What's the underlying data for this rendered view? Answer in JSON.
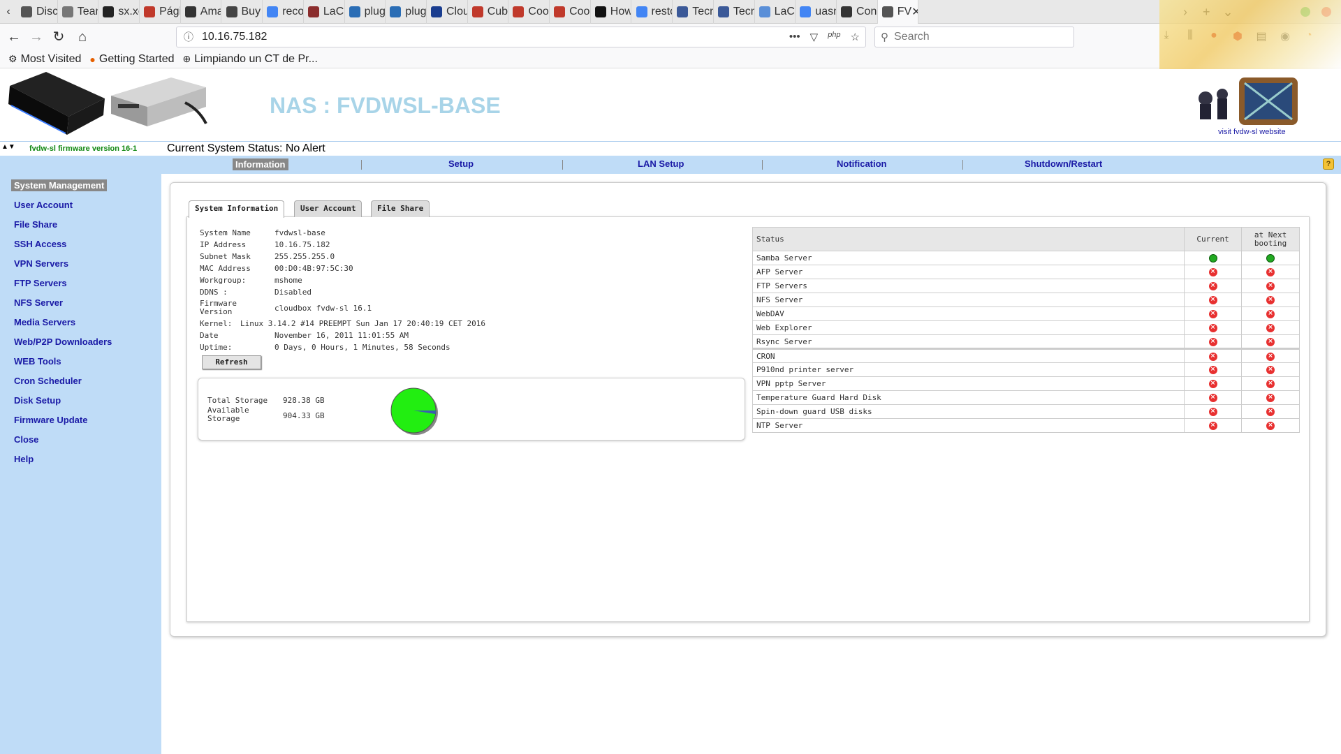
{
  "browser": {
    "tabs": [
      {
        "label": "Disc",
        "color": "#555"
      },
      {
        "label": "Team",
        "color": "#777"
      },
      {
        "label": "sx.xe",
        "color": "#222"
      },
      {
        "label": "Págir",
        "color": "#c0392b"
      },
      {
        "label": "Ama",
        "color": "#333"
      },
      {
        "label": "Buy",
        "color": "#444"
      },
      {
        "label": "recov",
        "color": "#4285f4"
      },
      {
        "label": "LaCi",
        "color": "#8b2d2d"
      },
      {
        "label": "plugc",
        "color": "#2a6db5"
      },
      {
        "label": "pluge",
        "color": "#2a6db5"
      },
      {
        "label": "Clou",
        "color": "#1a3d8f"
      },
      {
        "label": "Cuba",
        "color": "#c0392b"
      },
      {
        "label": "Coop",
        "color": "#c0392b"
      },
      {
        "label": "Coop",
        "color": "#c0392b"
      },
      {
        "label": "How",
        "color": "#111"
      },
      {
        "label": "resto",
        "color": "#4285f4"
      },
      {
        "label": "Tecn",
        "color": "#3b5998"
      },
      {
        "label": "Tecn",
        "color": "#3b5998"
      },
      {
        "label": "LaCi",
        "color": "#5a8fd8"
      },
      {
        "label": "uasn",
        "color": "#4285f4"
      },
      {
        "label": "Con",
        "color": "#333"
      },
      {
        "label": "FV",
        "color": "#555"
      }
    ],
    "url": "10.16.75.182",
    "url_badge": "php",
    "search_placeholder": "Search",
    "bookmarks": [
      {
        "label": "Most Visited",
        "icon": "gear-icon"
      },
      {
        "label": "Getting Started",
        "icon": "firefox-icon"
      },
      {
        "label": "Limpiando un CT de Pr...",
        "icon": "globe-icon"
      }
    ]
  },
  "header": {
    "title": "NAS : FVDWSL-BASE",
    "visit_link": "visit fvdw-sl website",
    "firmware_version": "fvdw-sl firmware version 16-1",
    "current_status": "Current System Status:  No Alert"
  },
  "menu": [
    {
      "label": "Information",
      "active": true
    },
    {
      "label": "Setup",
      "active": false
    },
    {
      "label": "LAN Setup",
      "active": false
    },
    {
      "label": "Notification",
      "active": false
    },
    {
      "label": "Shutdown/Restart",
      "active": false
    }
  ],
  "sidebar": [
    "System Management",
    "User Account",
    "File Share",
    "SSH Access",
    "VPN Servers",
    "FTP Servers",
    "NFS Server",
    "Media Servers",
    "Web/P2P Downloaders",
    "WEB Tools",
    "Cron Scheduler",
    "Disk Setup",
    "Firmware Update",
    "Close",
    "Help"
  ],
  "panel_tabs": [
    "System Information",
    "User Account",
    "File Share"
  ],
  "system_info": [
    {
      "label": "System Name",
      "value": "fvdwsl-base"
    },
    {
      "label": "IP Address",
      "value": "10.16.75.182"
    },
    {
      "label": "Subnet Mask",
      "value": "255.255.255.0"
    },
    {
      "label": "MAC Address",
      "value": "00:D0:4B:97:5C:30"
    },
    {
      "label": "Workgroup:",
      "value": "mshome"
    },
    {
      "label": "DDNS :",
      "value": "Disabled"
    },
    {
      "label": "Firmware\nVersion",
      "value": "cloudbox fvdw-sl 16.1"
    },
    {
      "label": "Kernel:",
      "value": "Linux 3.14.2 #14 PREEMPT Sun Jan 17 20:40:19 CET 2016"
    },
    {
      "label": "Date",
      "value": "November 16, 2011 11:01:55 AM"
    },
    {
      "label": "Uptime:",
      "value": "0 Days, 0 Hours, 1 Minutes, 58 Seconds"
    }
  ],
  "refresh_label": "Refresh",
  "storage": {
    "total_label": "Total Storage",
    "total_value": "928.38 GB",
    "available_label": "Available\nStorage",
    "available_value": "904.33 GB",
    "total_gb": 928.38,
    "available_gb": 904.33,
    "free_color": "#22ee11",
    "used_color": "#3a5fb0"
  },
  "status_table": {
    "headers": [
      "Status",
      "Current",
      "at Next\nbooting"
    ],
    "groups": [
      [
        {
          "name": "Samba Server",
          "current": true,
          "next": true
        },
        {
          "name": "AFP Server",
          "current": false,
          "next": false
        },
        {
          "name": "FTP Servers",
          "current": false,
          "next": false
        },
        {
          "name": "NFS Server",
          "current": false,
          "next": false
        },
        {
          "name": "WebDAV",
          "current": false,
          "next": false
        },
        {
          "name": "Web Explorer",
          "current": false,
          "next": false
        },
        {
          "name": "Rsync Server",
          "current": false,
          "next": false
        }
      ],
      [
        {
          "name": "CRON",
          "current": false,
          "next": false
        },
        {
          "name": "P910nd printer server",
          "current": false,
          "next": false
        },
        {
          "name": "VPN pptp Server",
          "current": false,
          "next": false
        },
        {
          "name": "Temperature Guard Hard Disk",
          "current": false,
          "next": false
        },
        {
          "name": "Spin-down guard USB disks",
          "current": false,
          "next": false
        },
        {
          "name": "NTP Server",
          "current": false,
          "next": false
        }
      ]
    ]
  }
}
